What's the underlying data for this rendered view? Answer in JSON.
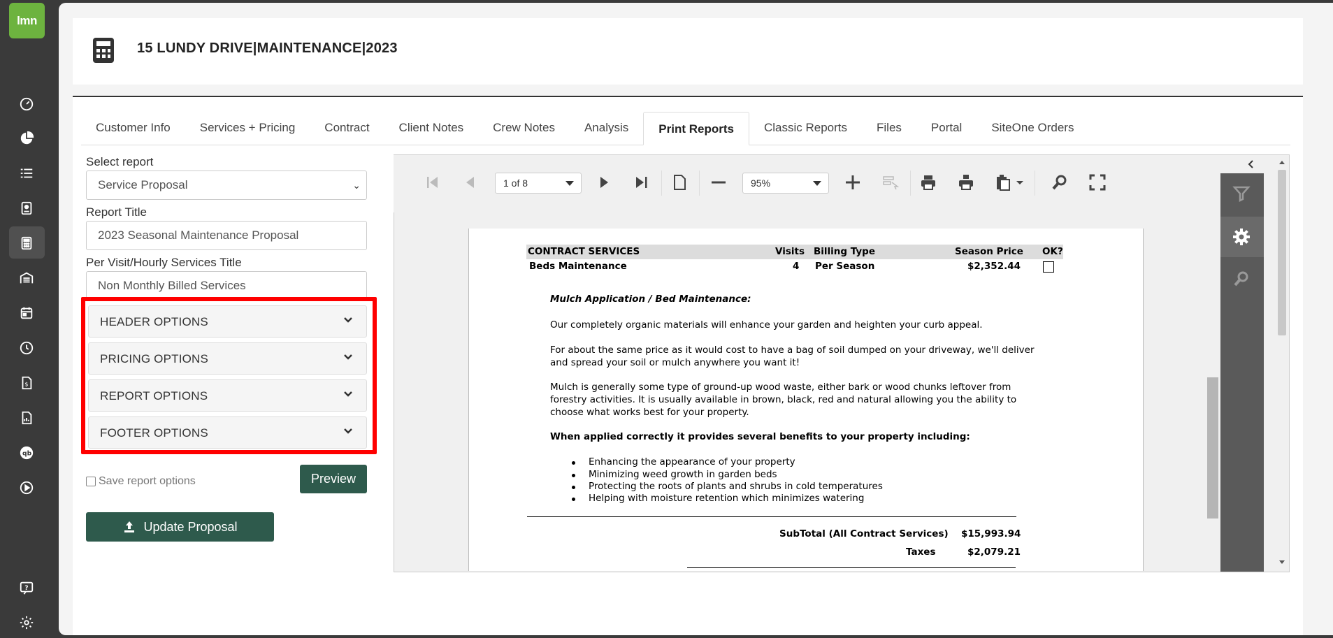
{
  "app": {
    "logo_text": "lmn",
    "accent_color": "#6db33f",
    "button_color": "#2e5a4c",
    "highlight_color": "#ff0000"
  },
  "header": {
    "title": "15 LUNDY DRIVE|MAINTENANCE|2023"
  },
  "tabs": [
    {
      "label": "Customer Info"
    },
    {
      "label": "Services + Pricing"
    },
    {
      "label": "Contract"
    },
    {
      "label": "Client Notes"
    },
    {
      "label": "Crew Notes"
    },
    {
      "label": "Analysis"
    },
    {
      "label": "Print Reports"
    },
    {
      "label": "Classic Reports"
    },
    {
      "label": "Files"
    },
    {
      "label": "Portal"
    },
    {
      "label": "SiteOne Orders"
    }
  ],
  "form": {
    "select_report_label": "Select report",
    "select_report_value": "Service Proposal",
    "report_title_label": "Report Title",
    "report_title_value": "2023 Seasonal Maintenance Proposal",
    "per_visit_label": "Per Visit/Hourly Services Title",
    "per_visit_value": "Non Monthly Billed Services",
    "options": [
      {
        "label": "HEADER OPTIONS"
      },
      {
        "label": "PRICING OPTIONS"
      },
      {
        "label": "REPORT OPTIONS"
      },
      {
        "label": "FOOTER OPTIONS"
      }
    ],
    "save_options_label": "Save report options",
    "preview_label": "Preview",
    "update_label": "Update Proposal"
  },
  "viewer": {
    "page_indicator": "1 of 8",
    "zoom": "95%"
  },
  "report": {
    "headers": {
      "services": "CONTRACT SERVICES",
      "visits": "Visits",
      "billing": "Billing Type",
      "price": "Season Price",
      "ok": "OK?"
    },
    "row": {
      "service": "Beds Maintenance",
      "visits": "4",
      "billing": "Per Season",
      "price": "$2,352.44"
    },
    "section_title": "Mulch Application / Bed Maintenance:",
    "para1": "Our completely organic materials will enhance your garden and heighten your curb appeal.",
    "para2_line1": "For about the same price as it would cost to have a bag of soil dumped on your driveway, we'll deliver",
    "para2_line2": "and spread your soil or mulch anywhere you want it!",
    "para3_line1": "Mulch is generally some type of ground-up wood waste, either bark or wood chunks leftover from",
    "para3_line2": "forestry activities.  It is usually available in brown, black, red and natural allowing you the ability to",
    "para3_line3": "choose what works best for your property.",
    "benefits_title": "When applied correctly it provides several benefits to your property including:",
    "bullets": [
      "Enhancing the appearance of your property",
      "Minimizing weed growth in garden beds",
      "Protecting the roots of plants and shrubs in cold temperatures",
      "Helping with moisture retention which minimizes watering"
    ],
    "subtotal_label": "SubTotal (All Contract Services)",
    "subtotal_value": "$15,993.94",
    "taxes_label": "Taxes",
    "taxes_value": "$2,079.21"
  }
}
